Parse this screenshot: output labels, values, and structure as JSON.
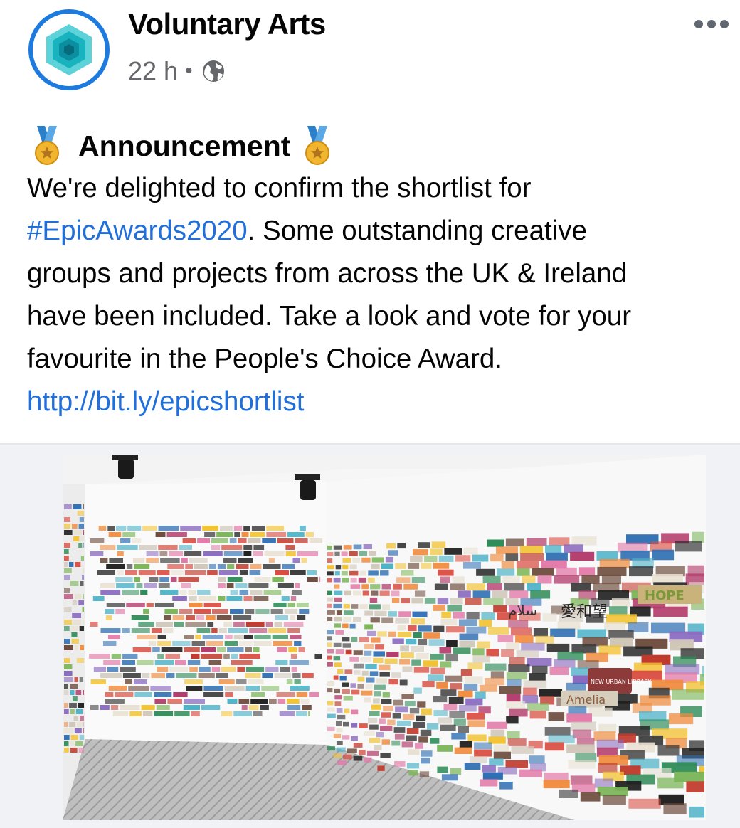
{
  "post": {
    "author": "Voluntary Arts",
    "time": "22 h",
    "separator": "•",
    "privacy_icon": "globe-icon",
    "more_icon": "more-dots-icon",
    "heading": "Announcement",
    "medal_icon": "medal-icon",
    "lines": [
      {
        "text": "We're delighted to confirm the shortlist for"
      },
      {
        "hashtag": "#EpicAwards2020",
        "rest": ". Some outstanding creative"
      },
      {
        "text": "groups and projects from across the UK & Ireland"
      },
      {
        "text": "have been included. Take a look and vote for your"
      },
      {
        "text": "favourite in the People's Choice Award."
      }
    ],
    "link": "http://bit.ly/epicshortlist"
  },
  "photo": {
    "description_icon": "gallery-photo",
    "wall_labels": {
      "arabic": "سلام",
      "chinese": "愛和望",
      "amelia": "Amelia",
      "library": "NEW URBAN LIBRARY",
      "hope": "HOPE"
    }
  },
  "colors": {
    "link": "#216fdb",
    "secondary_text": "#65676b",
    "avatar_ring": "#1d7be0",
    "avatar_teal": "#19b2bf"
  }
}
